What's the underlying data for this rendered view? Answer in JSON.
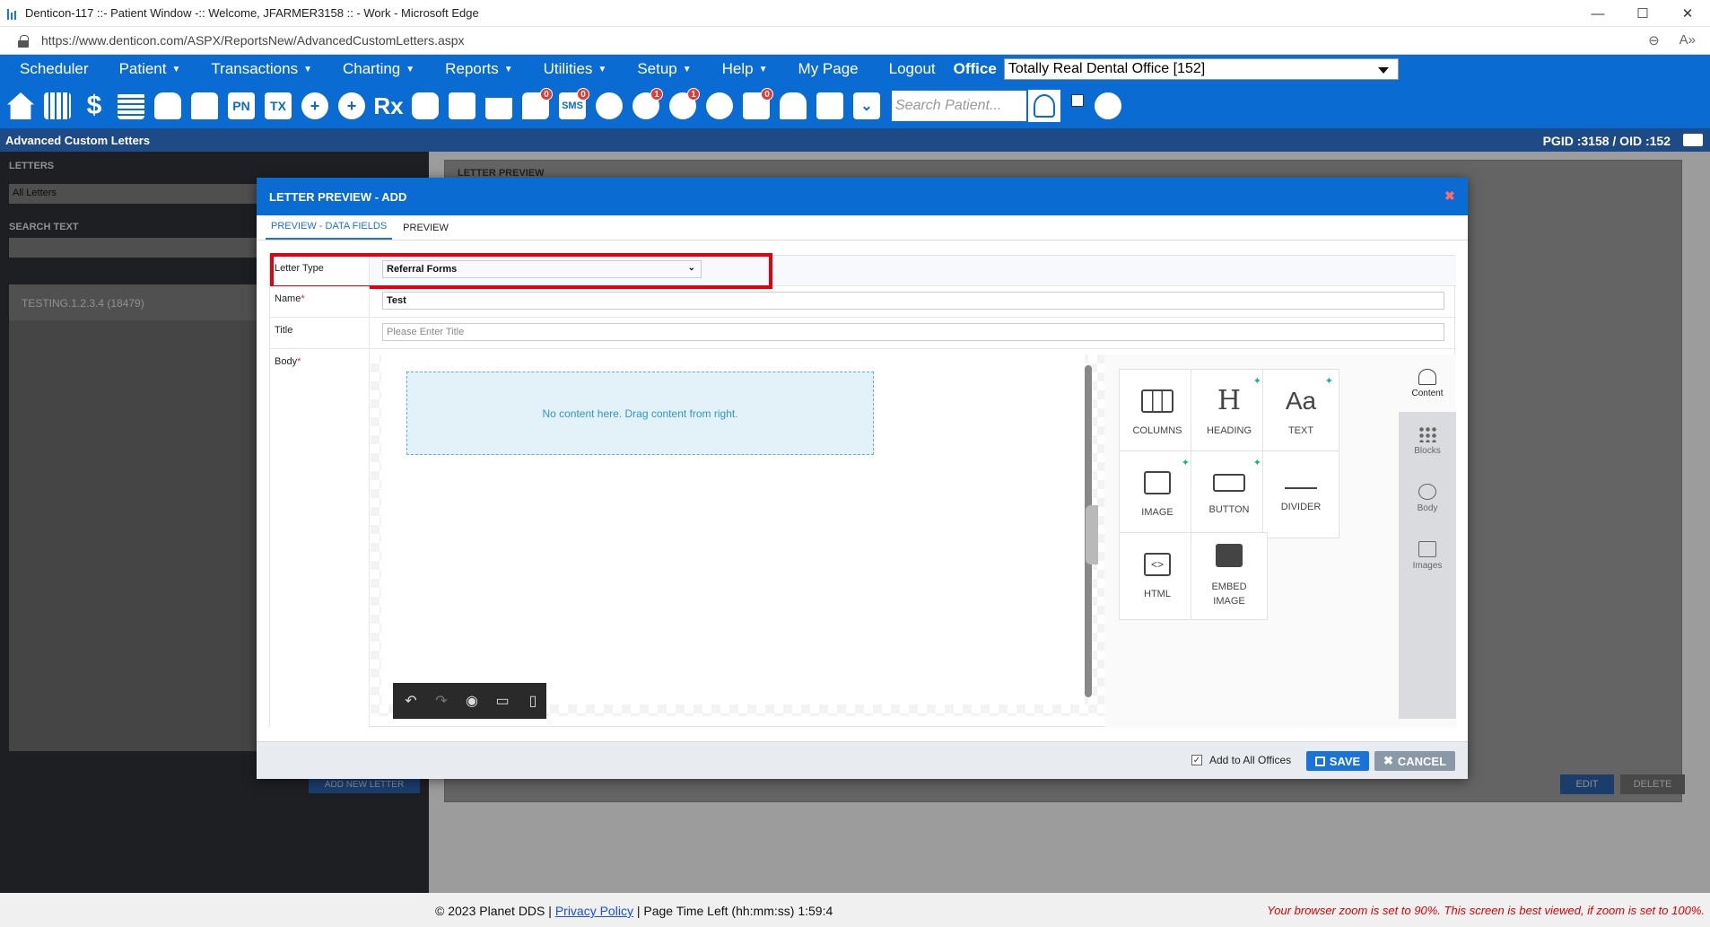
{
  "window": {
    "title": "Denticon-117 ::- Patient Window -:: Welcome, JFARMER3158 :: - Work - Microsoft Edge",
    "minimize": "—",
    "maximize": "☐",
    "close": "✕"
  },
  "address": {
    "url": "https://www.denticon.com/ASPX/ReportsNew/AdvancedCustomLetters.aspx",
    "zoom_icon": "⊖",
    "read_icon": "A»"
  },
  "nav": {
    "items": [
      "Scheduler",
      "Patient",
      "Transactions",
      "Charting",
      "Reports",
      "Utilities",
      "Setup",
      "Help",
      "My Page",
      "Logout"
    ],
    "caret": "▼",
    "office_label": "Office",
    "office_value": "Totally Real Dental Office [152]"
  },
  "toolbar": {
    "badges": {
      "sms": "0",
      "globe": "1",
      "refresh": "1",
      "message": "0",
      "clipboard": "0"
    },
    "pn_label": "PN",
    "tx_label": "TX",
    "rx_label": "Rx",
    "sms_label": "SMS",
    "search_placeholder": "Search Patient..."
  },
  "page_header": {
    "title": "Advanced Custom Letters",
    "ids": "PGID :3158  /  OID :152"
  },
  "left_panel": {
    "letters_label": "LETTERS",
    "letters_filter": "All Letters",
    "search_label": "SEARCH TEXT",
    "list_item": "TESTING.1.2.3.4 (18479)",
    "add_button": "ADD NEW LETTER"
  },
  "right_panel": {
    "label": "LETTER PREVIEW",
    "edit_button": "EDIT",
    "delete_button": "DELETE"
  },
  "modal": {
    "title": "LETTER PREVIEW - ADD",
    "close": "✖",
    "tabs": [
      "PREVIEW - DATA FIELDS",
      "PREVIEW"
    ],
    "letter_type_label": "Letter Type",
    "letter_type_value": "Referral Forms",
    "name_label": "Name",
    "name_value": "Test",
    "title_label": "Title",
    "title_placeholder": "Please Enter Title",
    "body_label": "Body",
    "required_mark": "*",
    "dropzone_text": "No content here. Drag content from right.",
    "tiles": [
      {
        "label": "COLUMNS"
      },
      {
        "label": "HEADING"
      },
      {
        "label": "TEXT"
      },
      {
        "label": "IMAGE"
      },
      {
        "label": "BUTTON"
      },
      {
        "label": "DIVIDER"
      },
      {
        "label": "HTML"
      },
      {
        "label": "EMBED IMAGE"
      }
    ],
    "side_tabs": [
      "Content",
      "Blocks",
      "Body",
      "Images"
    ],
    "add_all_offices": "Add to All Offices",
    "save": "SAVE",
    "cancel": "CANCEL"
  },
  "status": {
    "copyright": "© 2023 Planet DDS |",
    "privacy": "Privacy Policy",
    "time_left": "| Page Time Left (hh:mm:ss) 1:59:4",
    "zoom_warning": "Your browser zoom is set to 90%. This screen is best viewed, if zoom is set to 100%."
  },
  "colors": {
    "brand_blue": "#0a6bd2",
    "highlight_red": "#e4000f",
    "save_blue": "#1a73d8",
    "cancel_gray": "#8a98a8"
  }
}
